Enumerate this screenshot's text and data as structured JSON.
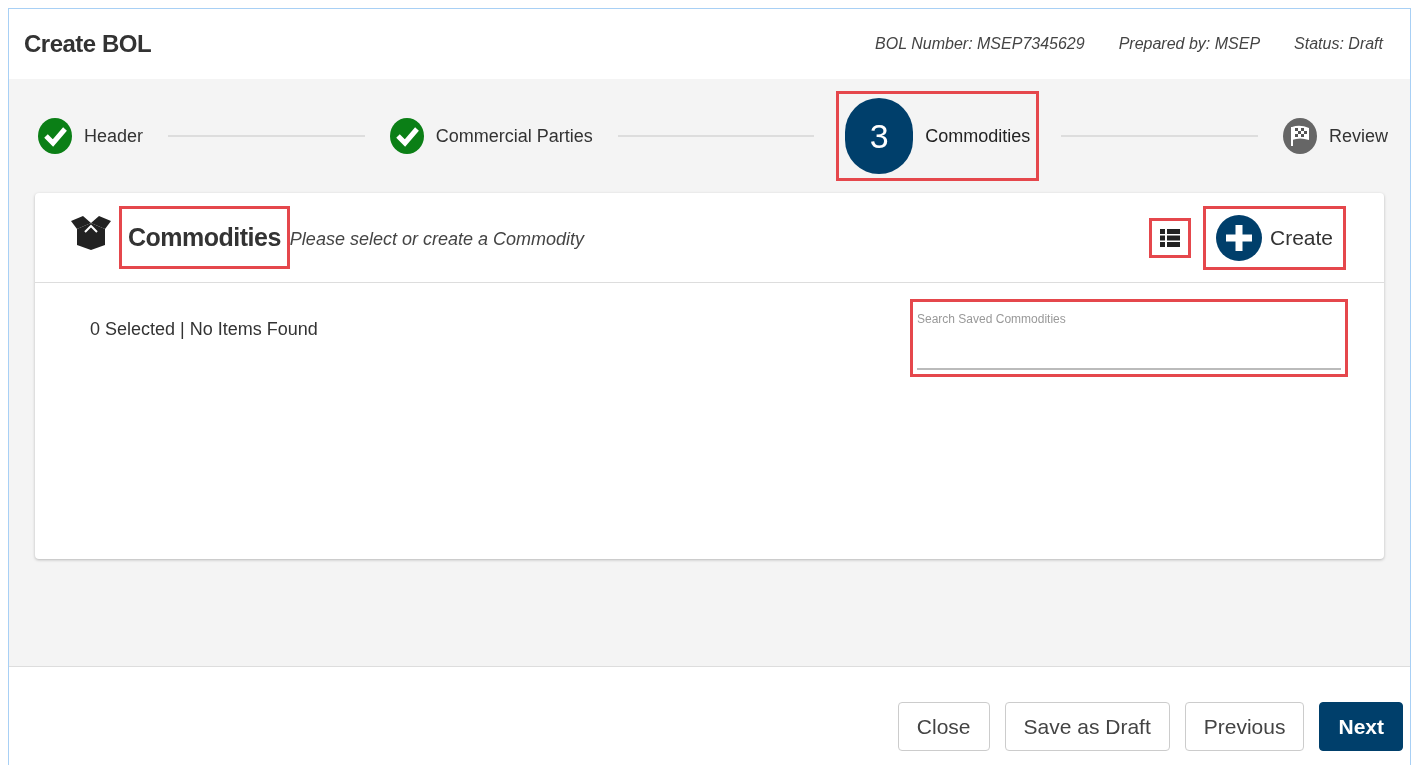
{
  "window": {
    "title": "Create BOL",
    "meta": [
      "BOL Number: MSEP7345629",
      "Prepared by: MSEP",
      "Status: Draft"
    ]
  },
  "steps": [
    {
      "kind": "done",
      "label": "Header",
      "selected": false,
      "highlighted": false
    },
    {
      "kind": "done",
      "label": "Commercial Parties",
      "selected": false,
      "highlighted": false
    },
    {
      "kind": "current",
      "number": "3",
      "label": "Commodities",
      "selected": true,
      "highlighted": true
    },
    {
      "kind": "final",
      "label": "Review",
      "selected": false,
      "highlighted": false
    }
  ],
  "panel": {
    "title": "Commodities",
    "title_highlighted": true,
    "subtitle": "Please select or create a Commodity",
    "list_view_highlighted": true,
    "create_label": "Create",
    "create_highlighted": true,
    "status": "0 Selected | No Items Found",
    "search": {
      "placeholder": "Search Saved Commodities",
      "highlighted": true
    }
  },
  "buttons": [
    {
      "label": "Close",
      "kind": "secondary"
    },
    {
      "label": "Save as Draft",
      "kind": "secondary"
    },
    {
      "label": "Previous",
      "kind": "secondary"
    },
    {
      "label": "Next",
      "kind": "primary"
    }
  ]
}
